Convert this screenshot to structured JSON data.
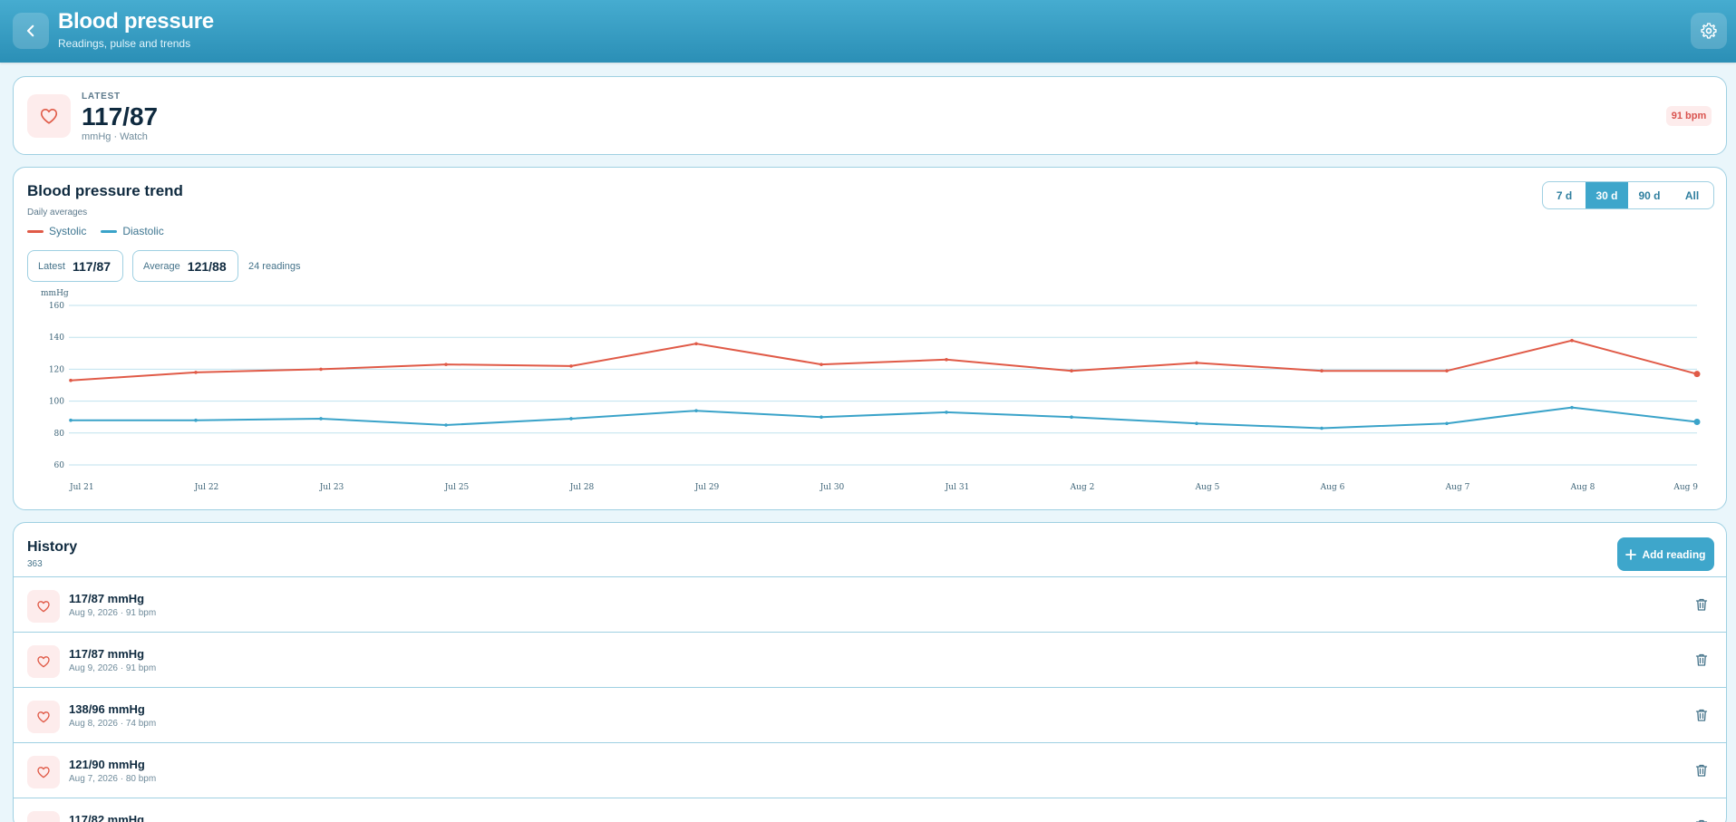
{
  "header": {
    "title": "Blood pressure",
    "subtitle": "Readings, pulse and trends",
    "back_icon": "chevron-left-icon",
    "settings_icon": "gear-icon"
  },
  "latest": {
    "kicker": "LATEST",
    "value": "117/87",
    "meta": "mmHg · Watch",
    "pulse_badge": "91 bpm",
    "icon": "heart-icon"
  },
  "trend": {
    "title": "Blood pressure trend",
    "subtitle": "Daily averages",
    "legend": [
      {
        "label": "Systolic",
        "color": "#e05a47"
      },
      {
        "label": "Diastolic",
        "color": "#3aa3c9"
      }
    ],
    "ranges": [
      {
        "label": "7 d",
        "active": false
      },
      {
        "label": "30 d",
        "active": true
      },
      {
        "label": "90 d",
        "active": false
      },
      {
        "label": "All",
        "active": false
      }
    ],
    "stats": {
      "latest_label": "Latest",
      "latest_value": "117/87",
      "average_label": "Average",
      "average_value": "121/88",
      "readings": "24 readings"
    }
  },
  "chart_data": {
    "type": "line",
    "ylabel": "mmHg",
    "ylim": [
      60,
      160
    ],
    "yticks": [
      60,
      80,
      100,
      120,
      140,
      160
    ],
    "grid": true,
    "categories": [
      "Jul 21",
      "Jul 22",
      "Jul 23",
      "Jul 25",
      "Jul 28",
      "Jul 29",
      "Jul 30",
      "Jul 31",
      "Aug 2",
      "Aug 5",
      "Aug 6",
      "Aug 7",
      "Aug 8",
      "Aug 9"
    ],
    "series": [
      {
        "name": "Systolic",
        "color": "#e05a47",
        "values": [
          113,
          118,
          120,
          123,
          122,
          136,
          123,
          126,
          119,
          124,
          119,
          119,
          138,
          117
        ]
      },
      {
        "name": "Diastolic",
        "color": "#3aa3c9",
        "values": [
          88,
          88,
          89,
          85,
          89,
          94,
          90,
          93,
          90,
          86,
          83,
          86,
          96,
          87
        ]
      }
    ]
  },
  "history": {
    "title": "History",
    "count": "363",
    "add_label": "Add reading",
    "rows": [
      {
        "reading": "117/87 mmHg",
        "detail": "Aug 9, 2026 · 91 bpm"
      },
      {
        "reading": "117/87 mmHg",
        "detail": "Aug 9, 2026 · 91 bpm"
      },
      {
        "reading": "138/96 mmHg",
        "detail": "Aug 8, 2026 · 74 bpm"
      },
      {
        "reading": "121/90 mmHg",
        "detail": "Aug 7, 2026 · 80 bpm"
      },
      {
        "reading": "117/82 mmHg",
        "detail": ""
      }
    ]
  }
}
